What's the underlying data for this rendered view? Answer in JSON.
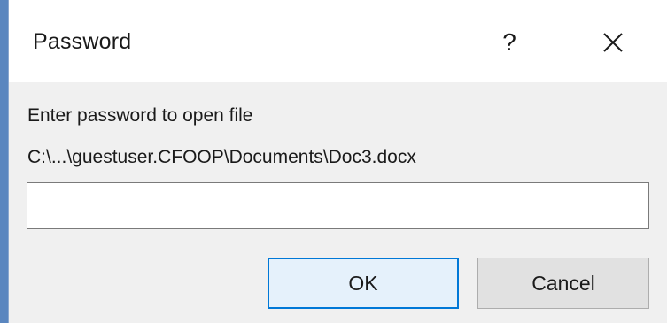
{
  "dialog": {
    "title": "Password",
    "help_label": "?",
    "prompt": "Enter password to open file",
    "file_path": "C:\\...\\guestuser.CFOOP\\Documents\\Doc3.docx",
    "password_value": "",
    "ok_label": "OK",
    "cancel_label": "Cancel"
  },
  "colors": {
    "accent": "#0078d7",
    "desktop": "#5a86bf",
    "dialog_body": "#f0f0f0"
  },
  "icons": {
    "close": "close-icon"
  }
}
